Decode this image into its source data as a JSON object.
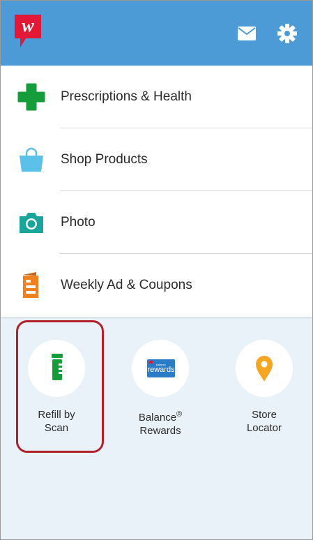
{
  "header": {
    "logo_letter": "w",
    "colors": {
      "bar": "#4d9bd6",
      "logo": "#e31837"
    }
  },
  "menu": {
    "items": [
      {
        "label": "Prescriptions & Health",
        "icon": "green-cross-icon"
      },
      {
        "label": "Shop Products",
        "icon": "shopping-bag-icon"
      },
      {
        "label": "Photo",
        "icon": "camera-icon"
      },
      {
        "label": "Weekly Ad & Coupons",
        "icon": "weekly-ad-icon"
      }
    ]
  },
  "tiles": [
    {
      "line1": "Refill by",
      "line2": "Scan",
      "icon": "pill-bottle-icon"
    },
    {
      "line1": "Balance",
      "sup": "®",
      "line2": "Rewards",
      "icon": "balance-rewards-card-icon",
      "card_text": "rewards",
      "card_small": "balance"
    },
    {
      "line1": "Store",
      "line2": "Locator",
      "icon": "map-pin-icon"
    }
  ],
  "highlight": {
    "target": "Refill by Scan",
    "color": "#b22029"
  }
}
